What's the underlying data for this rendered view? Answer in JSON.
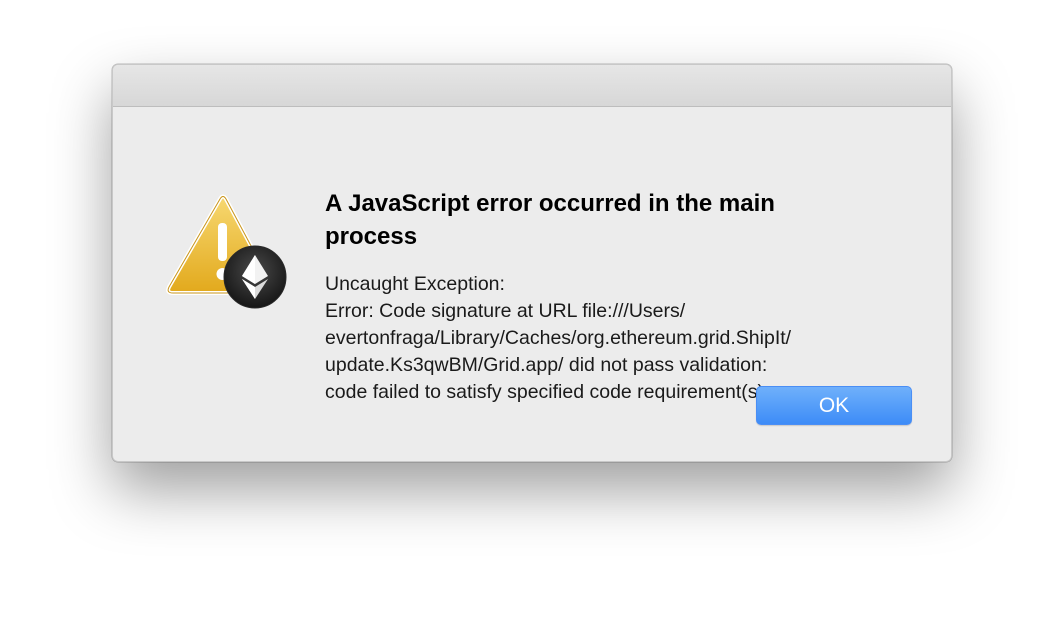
{
  "dialog": {
    "heading": "A JavaScript error occurred in the main process",
    "message_lines": [
      "Uncaught Exception:",
      "Error: Code signature at URL file:///Users/",
      "evertonfraga/Library/Caches/org.ethereum.grid.ShipIt/",
      "update.Ks3qwBM/Grid.app/ did not pass validation:",
      "code failed to satisfy specified code requirement(s)"
    ],
    "ok_label": "OK",
    "icons": {
      "warning": "warning-triangle-icon",
      "app": "ethereum-icon"
    },
    "colors": {
      "window_background": "#ececec",
      "button_blue": "#3d8cf7",
      "warning_yellow": "#f1c232"
    }
  }
}
